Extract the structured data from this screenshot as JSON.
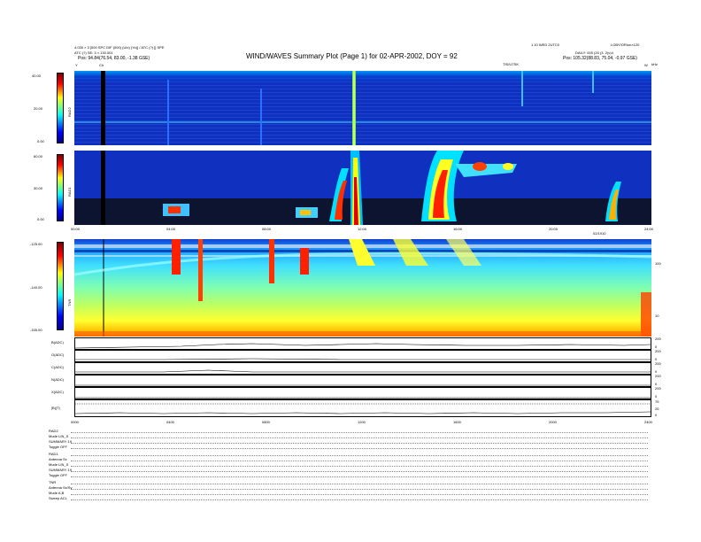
{
  "header": {
    "title": "WIND/WAVES Summary Plot (Page 1) for 02-APR-2002, DOY = 92",
    "top_left_line1": "4.030 × 3 [000 SPC DIF (000) (UIc) (Yo)] / ATC (?) [] SPE",
    "top_left_line2": "ATC (?) SE: 3 × 130.001",
    "top_left_pos": "Pos:   94.84(76.54, 83.00, -1.38 GSE)",
    "top_right_line0": "1.10 WED 2UTC0",
    "top_right_line1": "LOBY/ORIon×120",
    "top_right_line2": "DAILY:  000 (20 (3, 2(v)4",
    "top_right_pos": "Pos:   105.32(88.83, 75.04, -0.97 GSE)",
    "center_tag": "TIS/UTSK",
    "ch_marker": "Ch",
    "y_marker": "Y",
    "right_unit": "kHz",
    "w_marker": "W"
  },
  "rad2": {
    "ylabel": "RAD2",
    "colorbar_ticks": [
      "40.00",
      "20.00",
      "0.00"
    ]
  },
  "rad1": {
    "ylabel": "RAD1",
    "colorbar_ticks": [
      "60.00",
      "30.00",
      "0.00"
    ]
  },
  "time_axis_top": [
    "00:00",
    "04:00",
    "08:00",
    "12:00",
    "16:00",
    "20:00",
    "24:00"
  ],
  "time_axis_mid_label": "02/1910",
  "tnr": {
    "ylabel": "TNR",
    "colorbar_ticks": [
      "-125.00",
      "-140.00",
      "-155.00"
    ],
    "right_ticks": [
      "100",
      "10"
    ]
  },
  "timeseries": {
    "panels": [
      {
        "label": "B(ADC)",
        "ticks": [
          "200",
          "0"
        ]
      },
      {
        "label": "O(ADC)",
        "ticks": [
          "200",
          "0"
        ]
      },
      {
        "label": "C(ADC)",
        "ticks": [
          "200",
          "0"
        ]
      },
      {
        "label": "N(ADC)",
        "ticks": [
          "200",
          "0"
        ]
      },
      {
        "label": "X(ADC)",
        "ticks": [
          "200",
          "0"
        ]
      },
      {
        "label": "|B|(T)",
        "ticks": [
          "75",
          "25",
          "0"
        ]
      }
    ],
    "time_axis": [
      "0000",
      "0400",
      "0800",
      "1200",
      "1600",
      "2000",
      "2400"
    ]
  },
  "info": {
    "lines": [
      "RAD2",
      "Mode   LIN_S",
      "SUMMARY  1X",
      "Toggle   OFF",
      "RAD1",
      "Antenna   Sx",
      "Mode   LIN_S",
      "SUMMARY  1X",
      "Toggle   OFF",
      "TNR",
      "Antenna  Sx/Sy",
      "Mode     A,B",
      "Sweep    ACL"
    ]
  },
  "colors": {
    "background_blue": "#1030c0",
    "jet_colorbar": [
      "#00008f",
      "#0000ff",
      "#00ffff",
      "#ffff00",
      "#ff0000",
      "#800000"
    ]
  },
  "chart_data": [
    {
      "type": "heatmap",
      "name": "RAD2",
      "xlabel": "",
      "ylabel": "RAD2",
      "x": [
        "00:00",
        "04:00",
        "08:00",
        "12:00",
        "16:00",
        "20:00",
        "24:00"
      ],
      "colorbar_range": [
        0,
        40
      ]
    },
    {
      "type": "heatmap",
      "name": "RAD1",
      "xlabel": "",
      "ylabel": "RAD1",
      "x": [
        "00:00",
        "04:00",
        "08:00",
        "12:00",
        "16:00",
        "20:00",
        "24:00"
      ],
      "colorbar_range": [
        0,
        60
      ]
    },
    {
      "type": "heatmap",
      "name": "TNR",
      "xlabel": "",
      "ylabel": "TNR",
      "x": [
        "00:00",
        "04:00",
        "08:00",
        "12:00",
        "16:00",
        "20:00",
        "24:00"
      ],
      "colorbar_range": [
        -155,
        -125
      ],
      "y_right_ticks": [
        100,
        10
      ]
    },
    {
      "type": "line",
      "x": [
        "0000",
        "0400",
        "0800",
        "1200",
        "1600",
        "2000",
        "2400"
      ],
      "series": [
        {
          "name": "B(ADC)"
        },
        {
          "name": "O(ADC)"
        },
        {
          "name": "C(ADC)"
        },
        {
          "name": "N(ADC)"
        },
        {
          "name": "X(ADC)"
        },
        {
          "name": "|B|(T)"
        }
      ]
    }
  ]
}
